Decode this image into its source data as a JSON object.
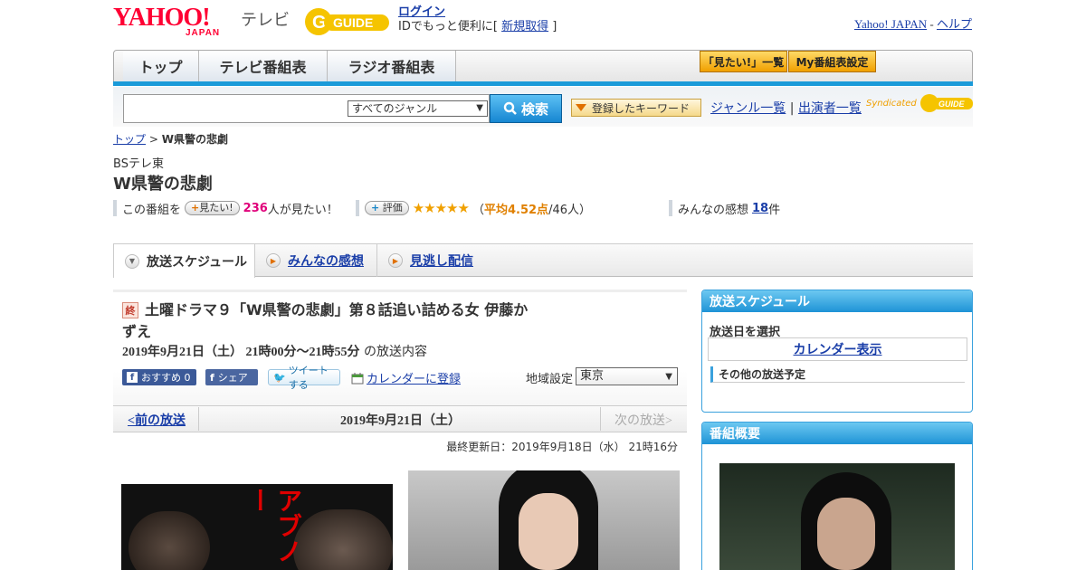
{
  "header": {
    "logo_text": "YAHOO!",
    "logo_sub": "JAPAN",
    "service_label": "テレビ",
    "gguide_label": "GUIDE",
    "login_link": "ログイン",
    "login_prefix": "IDでもっと便利に[",
    "register_link": "新規取得",
    "login_suffix": "]",
    "yj_link": "Yahoo! JAPAN",
    "separator": " - ",
    "help_link": "ヘルプ"
  },
  "nav": {
    "tabs": [
      "トップ",
      "テレビ番組表",
      "ラジオ番組表"
    ],
    "want_list": "「見たい!」一覧",
    "my_settings": "My番組表設定"
  },
  "search": {
    "input_value": "",
    "genre_selected": "すべてのジャンル",
    "button_label": "検索",
    "keyword_button": "登録したキーワード",
    "genre_list": "ジャンル一覧",
    "divider": "|",
    "cast_list": "出演者一覧",
    "syndicated": "Syndicated"
  },
  "breadcrumb": {
    "home": "トップ",
    "sep": " > ",
    "current": "W県警の悲劇"
  },
  "program": {
    "channel": "BSテレ東",
    "title": "W県警の悲劇",
    "want_prefix": "この番組を",
    "want_pill": "見たい!",
    "want_count": "236",
    "want_suffix": "人が見たい！",
    "rate_pill": "評価",
    "stars": "★★★★★",
    "rating_open": "（",
    "rating_avg": "平均4.52点",
    "rating_count": "/46人）",
    "rating_value": 4.52,
    "impressions_prefix": "みんなの感想 ",
    "impressions_count": "18",
    "impressions_suffix": "件"
  },
  "tabs": {
    "schedule": "放送スケジュール",
    "impressions": "みんなの感想",
    "streaming": "見逃し配信"
  },
  "episode": {
    "badge": "終",
    "title_line1": "土曜ドラマ９「W県警の悲劇」第８話追い詰める女 伊藤か",
    "title_line2": "ずえ",
    "datetime": "2019年9月21日（土） 21時00分～21時55分",
    "datetime_suffix": " の放送内容",
    "fb_recommend": "おすすめ 0",
    "fb_share": "シェア",
    "tweet": "ツイートする",
    "calendar_register": "カレンダーに登録",
    "region_label": "地域設定",
    "region_selected": "東京"
  },
  "date_nav": {
    "prev": "<前の放送",
    "current": "2019年9月21日（土）",
    "next": "次の放送>"
  },
  "updated": "最終更新日：2019年9月18日（水） 21時16分",
  "image_text": "アブノー",
  "sidebar": {
    "schedule_head": "放送スケジュール",
    "pick_date": "放送日を選択",
    "calendar_view": "カレンダー表示",
    "other_schedule": "その他の放送予定",
    "overview_head": "番組概要"
  },
  "colors": {
    "accent_blue": "#1a9ad9",
    "brand_red": "#ff0033",
    "link": "#1a3ea8",
    "orange": "#f0a000"
  }
}
